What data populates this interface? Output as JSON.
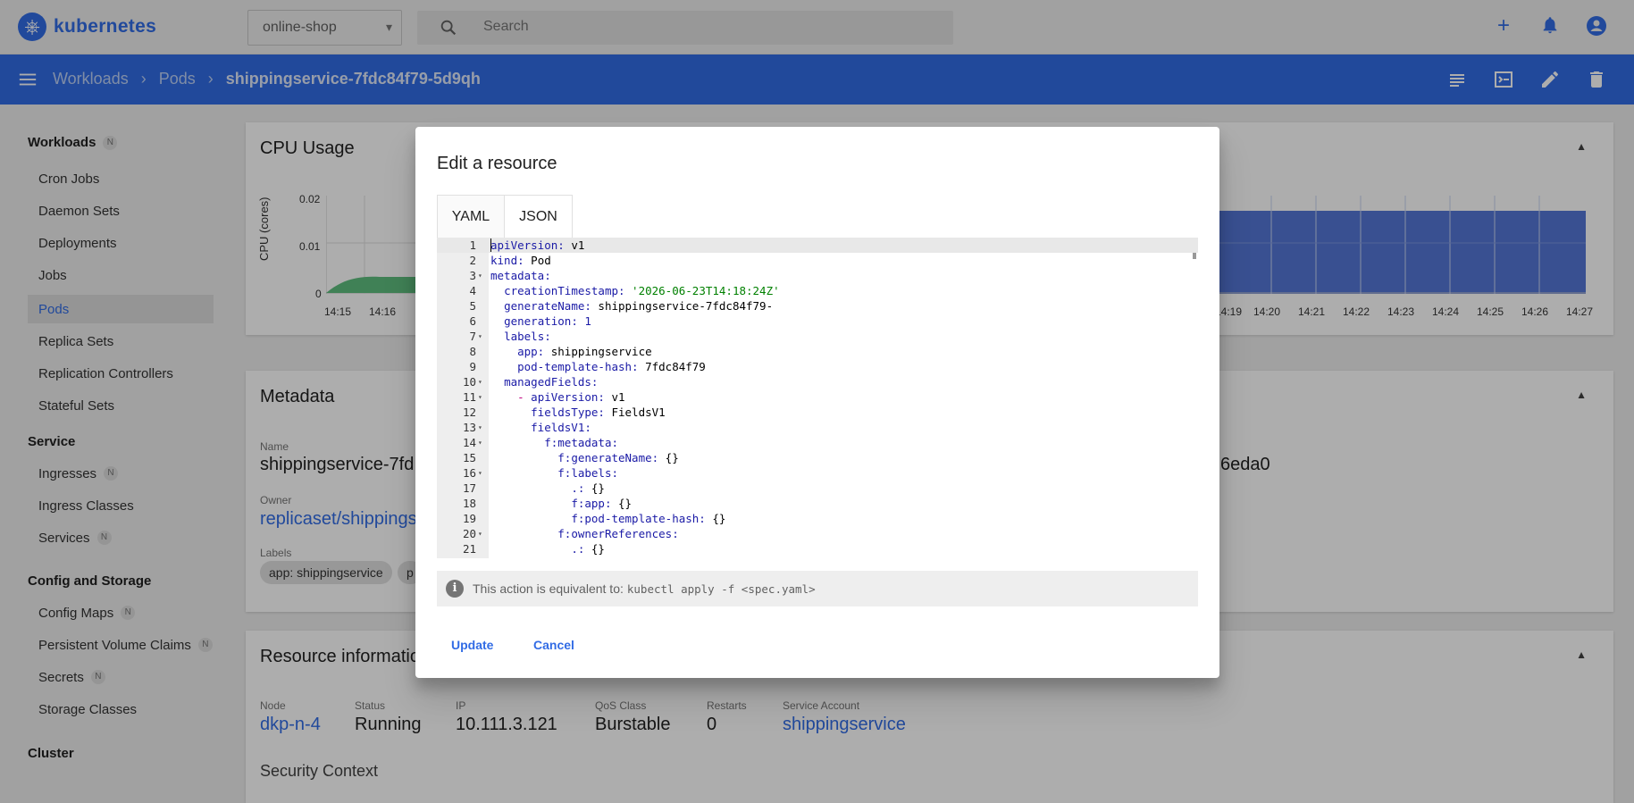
{
  "app": {
    "logo_text": "kubernetes",
    "logo_icon": "kubernetes-wheel-icon"
  },
  "namespace": {
    "value": "online-shop"
  },
  "search": {
    "placeholder": "Search"
  },
  "top_actions": [
    "add-icon",
    "notifications-icon",
    "account-icon"
  ],
  "breadcrumb": {
    "items": [
      "Workloads",
      "Pods"
    ],
    "current": "shippingservice-7fdc84f79-5d9qh"
  },
  "toolbar_actions": [
    "logs-icon",
    "exec-icon",
    "edit-icon",
    "delete-icon"
  ],
  "sidebar": {
    "workloads": {
      "label": "Workloads",
      "badge": "N"
    },
    "workload_items": [
      "Cron Jobs",
      "Daemon Sets",
      "Deployments",
      "Jobs",
      "Pods",
      "Replica Sets",
      "Replication Controllers",
      "Stateful Sets"
    ],
    "service": {
      "label": "Service"
    },
    "service_items": [
      {
        "label": "Ingresses",
        "badge": "N"
      },
      {
        "label": "Ingress Classes",
        "badge": ""
      },
      {
        "label": "Services",
        "badge": "N"
      }
    ],
    "config": {
      "label": "Config and Storage"
    },
    "config_items": [
      {
        "label": "Config Maps",
        "badge": "N"
      },
      {
        "label": "Persistent Volume Claims",
        "badge": "N"
      },
      {
        "label": "Secrets",
        "badge": "N"
      },
      {
        "label": "Storage Classes",
        "badge": ""
      }
    ],
    "cluster": {
      "label": "Cluster"
    }
  },
  "cpu_card": {
    "title": "CPU Usage",
    "ylabel": "CPU (cores)",
    "yticks": [
      "0.02",
      "0.01",
      "0"
    ],
    "xticks_left": [
      "14:15",
      "14:16"
    ],
    "xticks_right": [
      "14:19",
      "14:20",
      "14:21",
      "14:22",
      "14:23",
      "14:24",
      "14:25",
      "14:26",
      "14:27"
    ]
  },
  "metadata_card": {
    "title": "Metadata",
    "name_label": "Name",
    "name_value": "shippingservice-7fd",
    "uid_tail": "6eda0",
    "owner_label": "Owner",
    "owner_value": "replicaset/shippings",
    "labels_label": "Labels",
    "label_chip": "app: shippingservice",
    "label_chip2": "p"
  },
  "resource_card": {
    "title": "Resource informatio",
    "fields": [
      {
        "label": "Node",
        "value": "dkp-n-4",
        "link": true
      },
      {
        "label": "Status",
        "value": "Running",
        "link": false
      },
      {
        "label": "IP",
        "value": "10.111.3.121",
        "link": false
      },
      {
        "label": "QoS Class",
        "value": "Burstable",
        "link": false
      },
      {
        "label": "Restarts",
        "value": "0",
        "link": false
      },
      {
        "label": "Service Account",
        "value": "shippingservice",
        "link": true
      }
    ],
    "security_context": "Security Context"
  },
  "dialog": {
    "title": "Edit a resource",
    "tabs": [
      "YAML",
      "JSON"
    ],
    "info_text": "This action is equivalent to:",
    "info_cmd": "kubectl apply -f <spec.yaml>",
    "update_label": "Update",
    "cancel_label": "Cancel",
    "lines": [
      {
        "n": "1",
        "fold": false,
        "indent": "",
        "dash": "",
        "key": "apiVersion:",
        "val": " v1",
        "type": "plain"
      },
      {
        "n": "2",
        "fold": false,
        "indent": "",
        "dash": "",
        "key": "kind:",
        "val": " Pod",
        "type": "plain"
      },
      {
        "n": "3",
        "fold": true,
        "indent": "",
        "dash": "",
        "key": "metadata:",
        "val": "",
        "type": "plain"
      },
      {
        "n": "4",
        "fold": false,
        "indent": "  ",
        "dash": "",
        "key": "creationTimestamp:",
        "val": " '2026-06-23T14:18:24Z'",
        "type": "string"
      },
      {
        "n": "5",
        "fold": false,
        "indent": "  ",
        "dash": "",
        "key": "generateName:",
        "val": " shippingservice-7fdc84f79-",
        "type": "plain"
      },
      {
        "n": "6",
        "fold": false,
        "indent": "  ",
        "dash": "",
        "key": "generation:",
        "val": " 1",
        "type": "number"
      },
      {
        "n": "7",
        "fold": true,
        "indent": "  ",
        "dash": "",
        "key": "labels:",
        "val": "",
        "type": "plain"
      },
      {
        "n": "8",
        "fold": false,
        "indent": "    ",
        "dash": "",
        "key": "app:",
        "val": " shippingservice",
        "type": "plain"
      },
      {
        "n": "9",
        "fold": false,
        "indent": "    ",
        "dash": "",
        "key": "pod-template-hash:",
        "val": " 7fdc84f79",
        "type": "plain"
      },
      {
        "n": "10",
        "fold": true,
        "indent": "  ",
        "dash": "",
        "key": "managedFields:",
        "val": "",
        "type": "plain"
      },
      {
        "n": "11",
        "fold": true,
        "indent": "    ",
        "dash": "- ",
        "key": "apiVersion:",
        "val": " v1",
        "type": "plain"
      },
      {
        "n": "12",
        "fold": false,
        "indent": "      ",
        "dash": "",
        "key": "fieldsType:",
        "val": " FieldsV1",
        "type": "plain"
      },
      {
        "n": "13",
        "fold": true,
        "indent": "      ",
        "dash": "",
        "key": "fieldsV1:",
        "val": "",
        "type": "plain"
      },
      {
        "n": "14",
        "fold": true,
        "indent": "        ",
        "dash": "",
        "key": "f:metadata:",
        "val": "",
        "type": "plain"
      },
      {
        "n": "15",
        "fold": false,
        "indent": "          ",
        "dash": "",
        "key": "f:generateName:",
        "val": " {}",
        "type": "plain"
      },
      {
        "n": "16",
        "fold": true,
        "indent": "          ",
        "dash": "",
        "key": "f:labels:",
        "val": "",
        "type": "plain"
      },
      {
        "n": "17",
        "fold": false,
        "indent": "            ",
        "dash": "",
        "key": ".:",
        "val": " {}",
        "type": "plain"
      },
      {
        "n": "18",
        "fold": false,
        "indent": "            ",
        "dash": "",
        "key": "f:app:",
        "val": " {}",
        "type": "plain"
      },
      {
        "n": "19",
        "fold": false,
        "indent": "            ",
        "dash": "",
        "key": "f:pod-template-hash:",
        "val": " {}",
        "type": "plain"
      },
      {
        "n": "20",
        "fold": true,
        "indent": "          ",
        "dash": "",
        "key": "f:ownerReferences:",
        "val": "",
        "type": "plain"
      },
      {
        "n": "21",
        "fold": false,
        "indent": "            ",
        "dash": "",
        "key": ".:",
        "val": " {}",
        "type": "plain"
      }
    ]
  },
  "colors": {
    "brand": "#326ce5",
    "overlay": "rgba(0,0,0,0.32)",
    "yaml_key": "#1a1aa6",
    "yaml_string": "#008000",
    "yaml_dash": "#c00080"
  }
}
